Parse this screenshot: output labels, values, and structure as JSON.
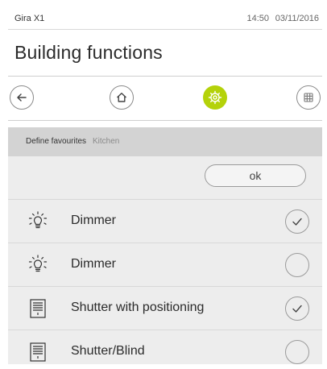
{
  "status": {
    "app_name": "Gira X1",
    "time": "14:50",
    "date": "03/11/2016"
  },
  "page": {
    "title": "Building functions"
  },
  "nav": {
    "buttons": [
      {
        "icon": "back-arrow-icon",
        "active": false
      },
      {
        "icon": "home-icon",
        "active": false
      },
      {
        "icon": "settings-gear-icon",
        "active": true
      },
      {
        "icon": "grid-icon",
        "active": false
      }
    ],
    "accent_color": "#b4d20a"
  },
  "subheader": {
    "label": "Define favourites",
    "room": "Kitchen"
  },
  "ok_button": {
    "label": "ok"
  },
  "functions": [
    {
      "label": "Dimmer",
      "icon": "lightbulb-icon",
      "checked": true
    },
    {
      "label": "Dimmer",
      "icon": "lightbulb-icon",
      "checked": false
    },
    {
      "label": "Shutter with positioning",
      "icon": "shutter-icon",
      "checked": true
    },
    {
      "label": "Shutter/Blind",
      "icon": "shutter-icon",
      "checked": false
    }
  ]
}
